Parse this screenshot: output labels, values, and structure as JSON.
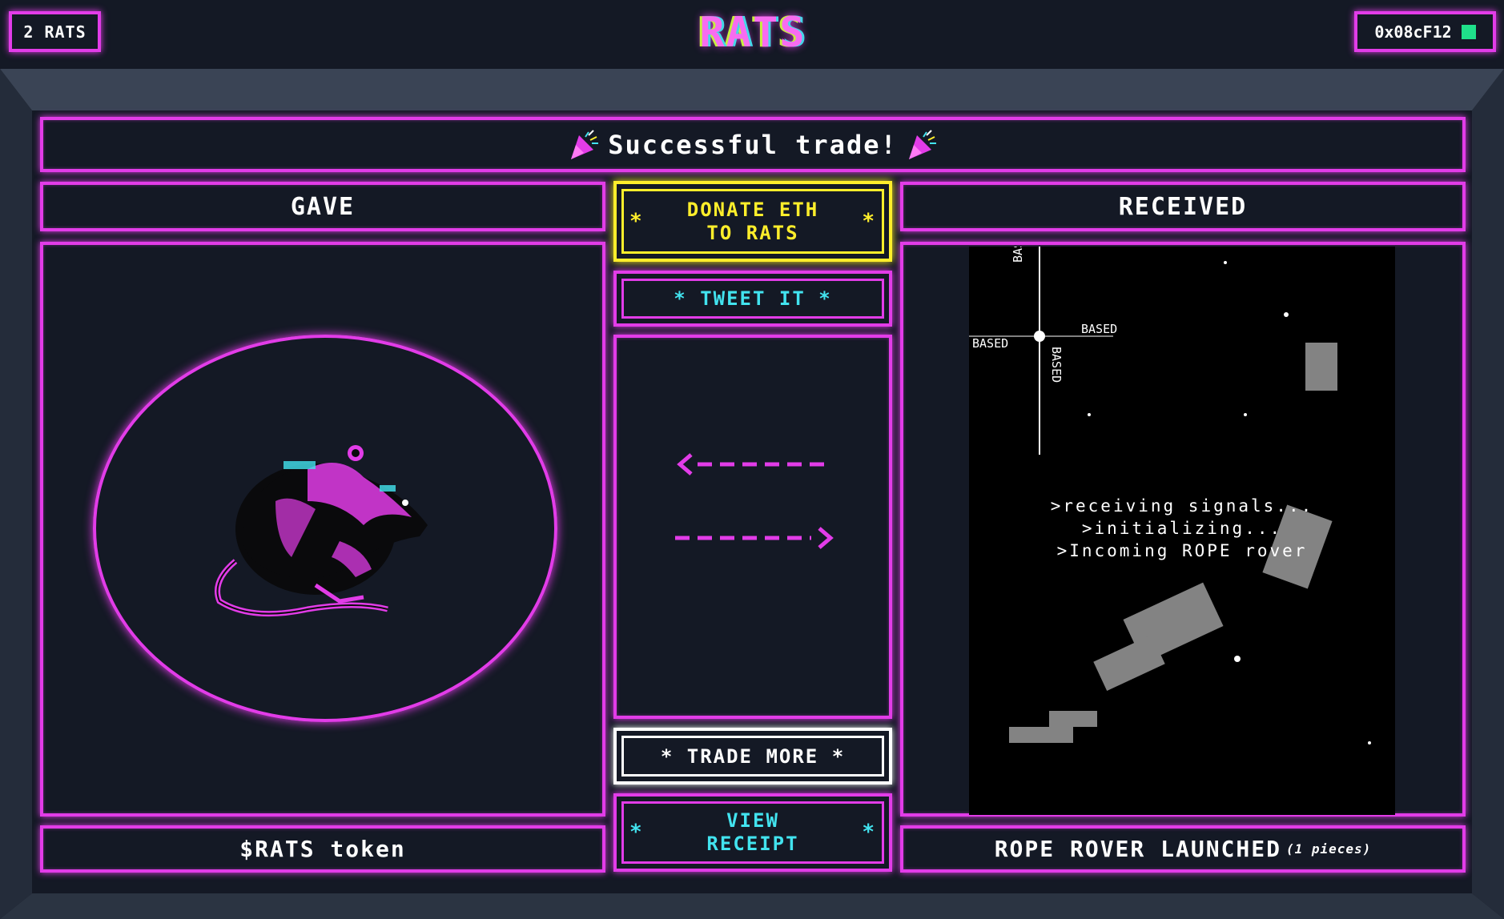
{
  "header": {
    "rats_count": "2 RATS",
    "logo": "RATS",
    "wallet_address": "0x08cF12",
    "wallet_status_color": "#1fe08a"
  },
  "banner": {
    "text": "Successful trade!",
    "icon": "party-popper-icon"
  },
  "gave": {
    "heading": "GAVE",
    "footer": "$RATS token",
    "image": "rat-icon"
  },
  "received": {
    "heading": "RECEIVED",
    "footer": "ROPE ROVER LAUNCHED",
    "footer_sub": "(1 pieces)",
    "terminal_lines": [
      ">receiving signals...",
      ">initializing...",
      ">Incoming ROPE rover"
    ],
    "nft_labels": [
      "BASED",
      "BASED",
      "BASED",
      "BASED"
    ]
  },
  "actions": {
    "donate_line1": "DONATE ETH",
    "donate_line2": "TO RATS",
    "tweet": "TWEET IT",
    "trade_more": "TRADE MORE",
    "receipt_line1": "VIEW",
    "receipt_line2": "RECEIPT",
    "star": "*"
  },
  "colors": {
    "accent": "#e23ce8",
    "donate": "#ffee2b",
    "cyan": "#42e3ef",
    "background": "#141925"
  }
}
